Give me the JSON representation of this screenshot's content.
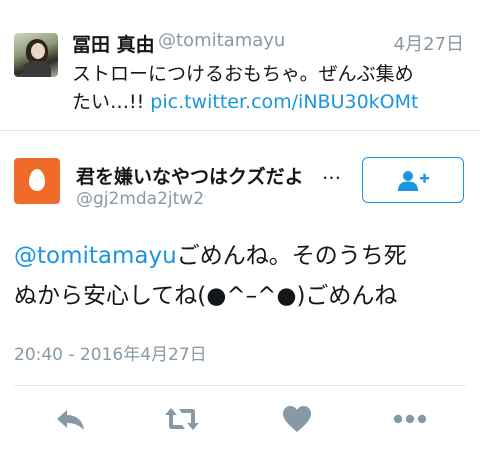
{
  "parent_tweet": {
    "name": "冨田 真由",
    "handle": "@tomitamayu",
    "date": "4月27日",
    "text_line1": "ストローにつけるおもちゃ。ぜんぶ集め",
    "text_line2": "たい…!! ",
    "link": "pic.twitter.com/iNBU30kOMt"
  },
  "main_tweet": {
    "name": "君を嫌いなやつはクズだよ",
    "ellipsis": "…",
    "handle": "@gj2mda2jtw2",
    "mention": "@tomitamayu",
    "text_after_mention": "ごめんね。そのうち死",
    "text_line2": "ぬから安心してね(●^–^●)ごめんね",
    "timestamp": "20:40 - 2016年4月27日"
  },
  "icons": {
    "follow": "add-user-icon",
    "reply": "reply-icon",
    "retweet": "retweet-icon",
    "like": "heart-icon",
    "more": "more-icon"
  },
  "colors": {
    "link_blue": "#1b95e0",
    "gray_text": "#8899a6",
    "action_gray": "#8899a6",
    "egg_avatar": "#f06a2a"
  }
}
